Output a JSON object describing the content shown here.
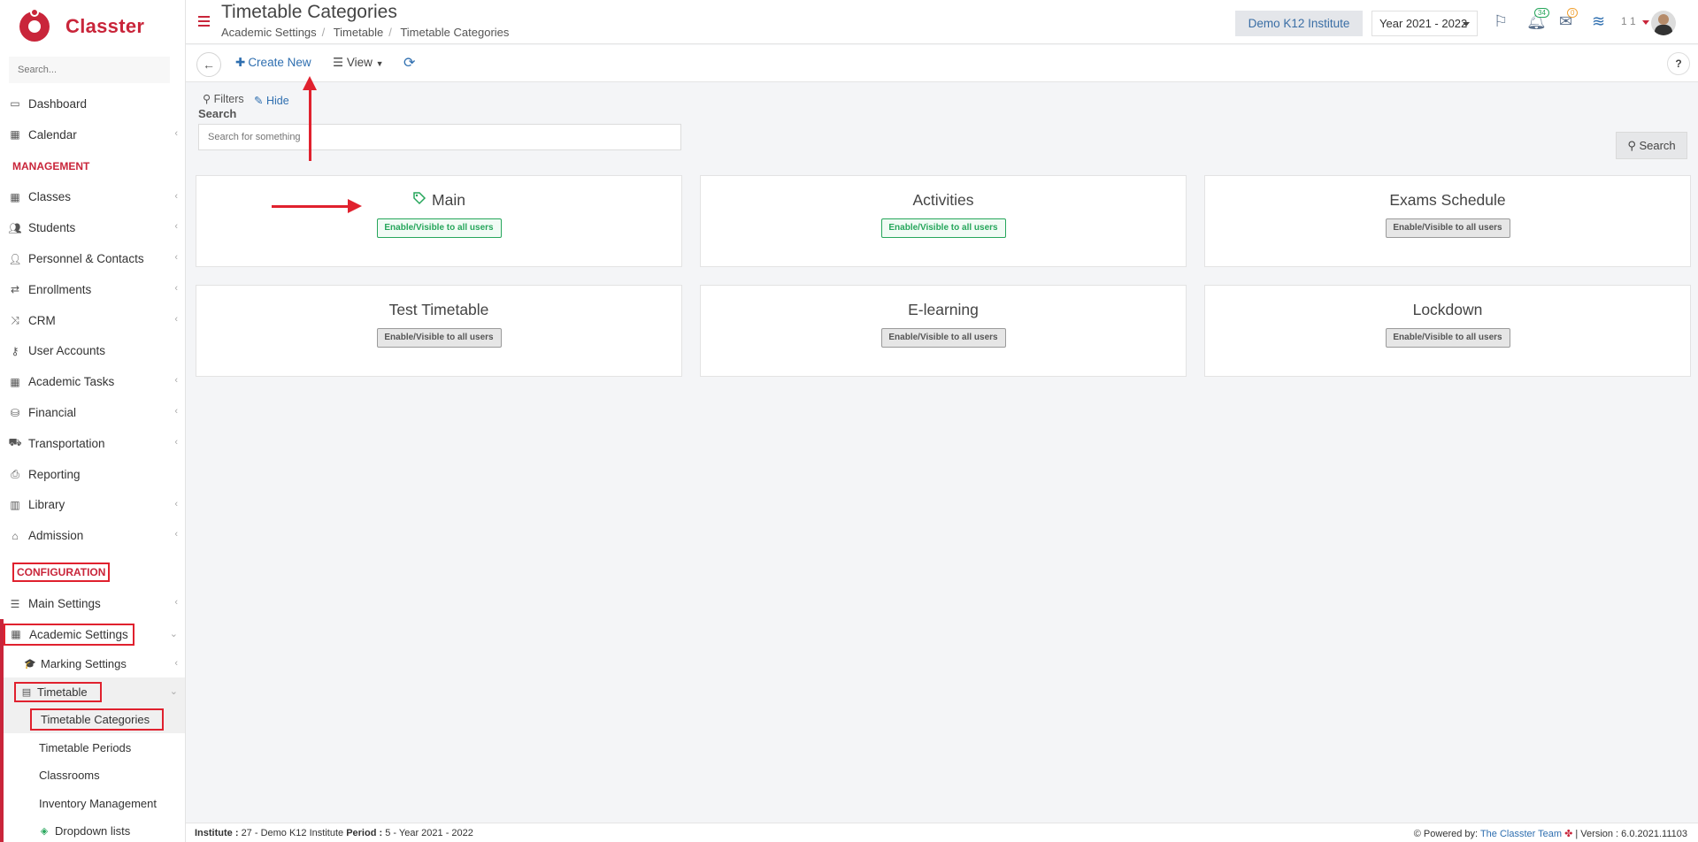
{
  "app": {
    "name": "Classter"
  },
  "sidebar": {
    "search_placeholder": "Search...",
    "items_top": [
      {
        "label": "Dashboard",
        "icon": "laptop-icon",
        "chev": false
      },
      {
        "label": "Calendar",
        "icon": "calendar-icon",
        "chev": true
      }
    ],
    "management_label": "MANAGEMENT",
    "items_management": [
      {
        "label": "Classes",
        "icon": "classes-icon",
        "chev": true
      },
      {
        "label": "Students",
        "icon": "students-icon",
        "chev": true
      },
      {
        "label": "Personnel & Contacts",
        "icon": "personnel-icon",
        "chev": true
      },
      {
        "label": "Enrollments",
        "icon": "exchange-icon",
        "chev": true
      },
      {
        "label": "CRM",
        "icon": "crm-icon",
        "chev": true
      },
      {
        "label": "User Accounts",
        "icon": "key-icon",
        "chev": false
      },
      {
        "label": "Academic Tasks",
        "icon": "tasks-icon",
        "chev": true
      },
      {
        "label": "Financial",
        "icon": "coins-icon",
        "chev": true
      },
      {
        "label": "Transportation",
        "icon": "bus-icon",
        "chev": true
      },
      {
        "label": "Reporting",
        "icon": "printer-icon",
        "chev": false
      },
      {
        "label": "Library",
        "icon": "library-icon",
        "chev": true
      },
      {
        "label": "Admission",
        "icon": "bank-icon",
        "chev": true
      }
    ],
    "configuration_label": "CONFIGURATION",
    "main_settings": "Main Settings",
    "academic_settings": "Academic Settings",
    "marking_settings": "Marking Settings",
    "timetable": "Timetable",
    "timetable_children": [
      "Timetable Categories",
      "Timetable Periods",
      "Classrooms",
      "Inventory Management"
    ],
    "dropdown_lists": "Dropdown lists"
  },
  "header": {
    "title": "Timetable Categories",
    "breadcrumb": [
      "Academic Settings",
      "Timetable",
      "Timetable Categories"
    ],
    "institute": "Demo K12 Institute",
    "year": "Year 2021 - 2022",
    "notifications_count": "34",
    "messages_count": "0",
    "user_count": "1 1"
  },
  "toolbar": {
    "create_label": "Create New",
    "view_label": "View"
  },
  "filters": {
    "filters_label": "Filters",
    "hide_label": "Hide",
    "search_label": "Search",
    "search_placeholder": "Search for something",
    "search_button": "Search"
  },
  "categories": [
    {
      "name": "Main",
      "badge": "Enable/Visible to all users",
      "enabled": true,
      "tag": true
    },
    {
      "name": "Activities",
      "badge": "Enable/Visible to all users",
      "enabled": true,
      "tag": false
    },
    {
      "name": "Exams Schedule",
      "badge": "Enable/Visible to all users",
      "enabled": false,
      "tag": false
    },
    {
      "name": "Test Timetable",
      "badge": "Enable/Visible to all users",
      "enabled": false,
      "tag": false
    },
    {
      "name": "E-learning",
      "badge": "Enable/Visible to all users",
      "enabled": false,
      "tag": false
    },
    {
      "name": "Lockdown",
      "badge": "Enable/Visible to all users",
      "enabled": false,
      "tag": false
    }
  ],
  "footer": {
    "institute_label": "Institute :",
    "institute_value": "27 - Demo K12 Institute",
    "period_label": "Period :",
    "period_value": "5 - Year 2021 - 2022",
    "powered_label": "Powered by:",
    "powered_link": "The Classter Team",
    "version": "| Version : 6.0.2021.11103"
  },
  "colors": {
    "brand": "#c9253a",
    "link": "#2f6fb0",
    "success": "#26a65b",
    "annotation": "#e0212e"
  }
}
